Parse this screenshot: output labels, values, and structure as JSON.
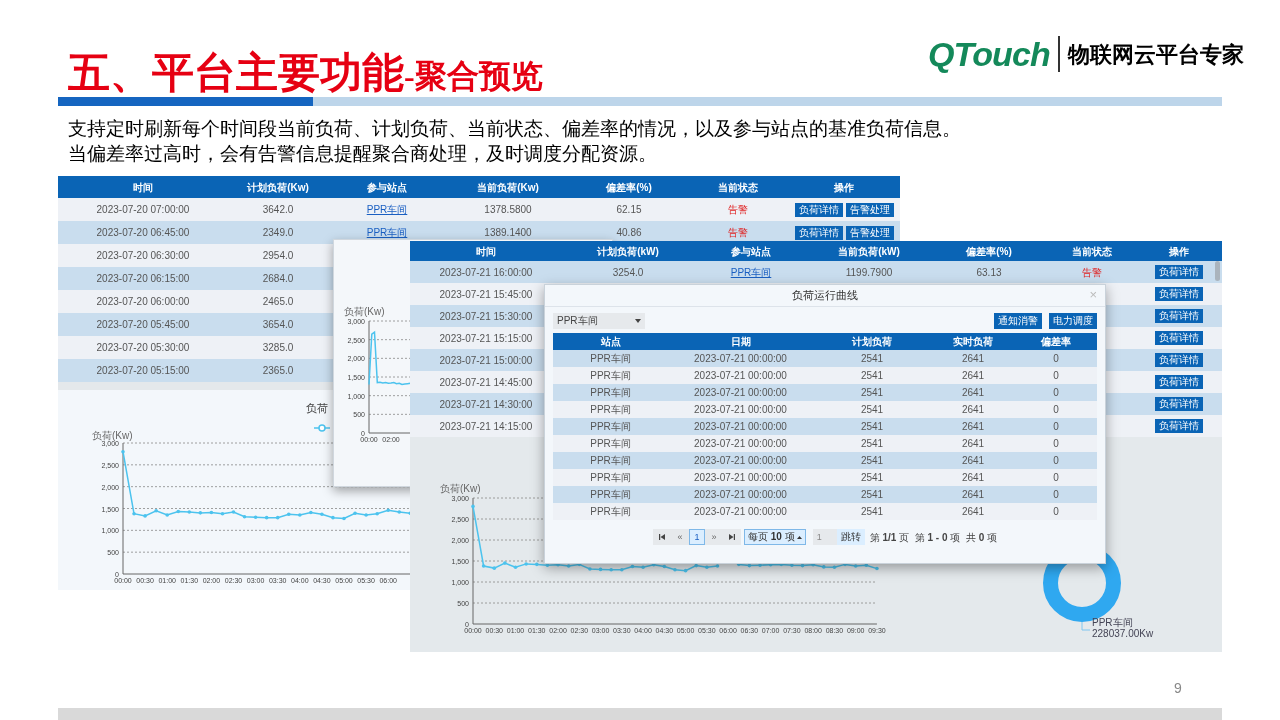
{
  "title": {
    "main": "五、平台主要功能",
    "sub": "-聚合预览"
  },
  "logo": {
    "brand": "QTouch",
    "tagline": "物联网云平台专家"
  },
  "description": [
    "支持定时刷新每个时间段当前负荷、计划负荷、当前状态、偏差率的情况，以及参与站点的基准负荷信息。",
    "当偏差率过高时，会有告警信息提醒聚合商处理，及时调度分配资源。"
  ],
  "table_1": {
    "columns": [
      "时间",
      "计划负荷(Kw)",
      "参与站点",
      "当前负荷(Kw)",
      "偏差率(%)",
      "当前状态",
      "操作"
    ],
    "rows": [
      {
        "time": "2023-07-20 07:00:00",
        "plan": "3642.0",
        "site": "PPR车间",
        "current": "1378.5800",
        "deviation": "62.15",
        "status": "告警",
        "actions": [
          "负荷详情",
          "告警处理"
        ]
      },
      {
        "time": "2023-07-20 06:45:00",
        "plan": "2349.0",
        "site": "PPR车间",
        "current": "1389.1400",
        "deviation": "40.86",
        "status": "告警",
        "actions": [
          "负荷详情",
          "告警处理"
        ]
      },
      {
        "time": "2023-07-20 06:30:00",
        "plan": "2954.0"
      },
      {
        "time": "2023-07-20 06:15:00",
        "plan": "2684.0"
      },
      {
        "time": "2023-07-20 06:00:00",
        "plan": "2465.0"
      },
      {
        "time": "2023-07-20 05:45:00",
        "plan": "3654.0"
      },
      {
        "time": "2023-07-20 05:30:00",
        "plan": "3285.0"
      },
      {
        "time": "2023-07-20 05:15:00",
        "plan": "2365.0"
      }
    ]
  },
  "chart_1": {
    "chart_data": {
      "type": "line",
      "title": "负荷",
      "ylabel": "负荷(Kw)",
      "categories": [
        "00:00",
        null,
        "00:30",
        null,
        "01:00",
        null,
        "01:30",
        null,
        "02:00",
        null,
        "02:30",
        null,
        "03:00",
        null,
        "03:30",
        null,
        "04:00",
        null,
        "04:30",
        null,
        "05:00",
        null,
        "05:30",
        null,
        "06:00",
        null,
        null
      ],
      "values": [
        2800,
        1380,
        1330,
        1450,
        1350,
        1430,
        1420,
        1400,
        1410,
        1380,
        1420,
        1310,
        1300,
        1290,
        1290,
        1370,
        1350,
        1410,
        1370,
        1290,
        1270,
        1390,
        1350,
        1380,
        1460,
        1420,
        1390
      ],
      "grid": true,
      "ylim": [
        0,
        3000
      ],
      "yticks": [
        0,
        500,
        {
          "value": 1000,
          "label": "1,000"
        },
        {
          "value": 1500,
          "label": "1,500"
        },
        {
          "value": 2000,
          "label": "2,000"
        },
        {
          "value": 2500,
          "label": "2,500"
        },
        {
          "value": 3000,
          "label": "3,000"
        }
      ]
    }
  },
  "chart_2": {
    "chart_data": {
      "type": "line",
      "ylabel": "负荷(Kw)",
      "categories": [
        "00:00",
        null,
        null,
        null,
        null,
        null,
        null,
        null,
        "02:00",
        null,
        null,
        null,
        null,
        null,
        null,
        null,
        null
      ],
      "values": [
        1300,
        2650,
        2700,
        1350,
        1360,
        1340,
        1350,
        1330,
        1340,
        1350,
        1320,
        1330,
        1300,
        1310,
        1320,
        1330,
        null
      ],
      "grid": true,
      "ylim": [
        0,
        3000
      ],
      "yticks": [
        0,
        500,
        {
          "value": 1000,
          "label": "1,000"
        },
        {
          "value": 1500,
          "label": "1,500"
        },
        {
          "value": 2000,
          "label": "2,000"
        },
        {
          "value": 2500,
          "label": "2,500"
        },
        {
          "value": 3000,
          "label": "3,000"
        }
      ]
    }
  },
  "table_2": {
    "columns": [
      "时间",
      "计划负荷(kW)",
      "参与站点",
      "当前负荷(kW)",
      "偏差率(%)",
      "当前状态",
      "操作"
    ],
    "rows": [
      {
        "time": "2023-07-21 16:00:00",
        "plan": "3254.0",
        "site": "PPR车间",
        "current": "1199.7900",
        "deviation": "63.13",
        "status": "告警",
        "actions": [
          "负荷详情"
        ]
      },
      {
        "time": "2023-07-21 15:45:00",
        "actions": [
          "负荷详情"
        ]
      },
      {
        "time": "2023-07-21 15:30:00",
        "actions": [
          "负荷详情"
        ]
      },
      {
        "time": "2023-07-21 15:15:00",
        "actions": [
          "负荷详情"
        ]
      },
      {
        "time": "2023-07-21 15:00:00",
        "actions": [
          "负荷详情"
        ]
      },
      {
        "time": "2023-07-21 14:45:00",
        "actions": [
          "负荷详情"
        ]
      },
      {
        "time": "2023-07-21 14:30:00",
        "actions": [
          "负荷详情"
        ]
      },
      {
        "time": "2023-07-21 14:15:00",
        "actions": [
          "负荷详情"
        ]
      }
    ]
  },
  "chart_3": {
    "chart_data": {
      "type": "line",
      "ylabel": "负荷(Kw)",
      "categories": [
        "00:00",
        null,
        "00:30",
        null,
        "01:00",
        null,
        "01:30",
        null,
        "02:00",
        null,
        "02:30",
        null,
        "03:00",
        null,
        "03:30",
        null,
        "04:00",
        null,
        "04:30",
        null,
        "05:00",
        null,
        "05:30",
        null,
        "06:00",
        null,
        "06:30",
        null,
        "07:00",
        null,
        "07:30",
        null,
        "08:00",
        null,
        "08:30",
        null,
        "09:00",
        null,
        "09:30"
      ],
      "grid": true,
      "values": [
        2800,
        1380,
        1330,
        1450,
        1350,
        1430,
        1420,
        1400,
        1410,
        1380,
        1420,
        1310,
        1300,
        1290,
        1290,
        1370,
        1350,
        1410,
        1370,
        1290,
        1270,
        1390,
        1350,
        1380,
        null,
        1420,
        1390,
        1400,
        1410,
        1420,
        1400,
        1390,
        1410,
        1360,
        1350,
        1420,
        1380,
        1400,
        1320
      ],
      "ylim": [
        0,
        3000
      ],
      "yticks": [
        0,
        500,
        {
          "value": 1000,
          "label": "1,000"
        },
        {
          "value": 1500,
          "label": "1,500"
        },
        {
          "value": 2000,
          "label": "2,000"
        },
        {
          "value": 2500,
          "label": "2,500"
        },
        {
          "value": 3000,
          "label": "3,000"
        }
      ]
    }
  },
  "donut": {
    "label": "PPR车间",
    "value_label": "228037.00Kw"
  },
  "modal": {
    "title": "负荷运行曲线",
    "close": "×",
    "dropdown": {
      "value": "PPR车间"
    },
    "buttons": [
      "通知消警",
      "电力调度"
    ],
    "columns": [
      "站点",
      "日期",
      "计划负荷",
      "实时负荷",
      "偏差率"
    ],
    "rows": [
      [
        "PPR车间",
        "2023-07-21 00:00:00",
        "2541",
        "2641",
        "0"
      ],
      [
        "PPR车间",
        "2023-07-21 00:00:00",
        "2541",
        "2641",
        "0"
      ],
      [
        "PPR车间",
        "2023-07-21 00:00:00",
        "2541",
        "2641",
        "0"
      ],
      [
        "PPR车间",
        "2023-07-21 00:00:00",
        "2541",
        "2641",
        "0"
      ],
      [
        "PPR车间",
        "2023-07-21 00:00:00",
        "2541",
        "2641",
        "0"
      ],
      [
        "PPR车间",
        "2023-07-21 00:00:00",
        "2541",
        "2641",
        "0"
      ],
      [
        "PPR车间",
        "2023-07-21 00:00:00",
        "2541",
        "2641",
        "0"
      ],
      [
        "PPR车间",
        "2023-07-21 00:00:00",
        "2541",
        "2641",
        "0"
      ],
      [
        "PPR车间",
        "2023-07-21 00:00:00",
        "2541",
        "2641",
        "0"
      ],
      [
        "PPR车间",
        "2023-07-21 00:00:00",
        "2541",
        "2641",
        "0"
      ]
    ],
    "pager": {
      "prev": "«",
      "next": "»",
      "pages": [
        {
          "label": "1",
          "selected": true
        }
      ],
      "page_size": "每页 **10** 项",
      "jump_value": "1",
      "jump_button": "跳转",
      "summary": "第 **1/1** 页  第 **1 - 0** 项  共 **0** 项"
    }
  },
  "page_number": "9"
}
